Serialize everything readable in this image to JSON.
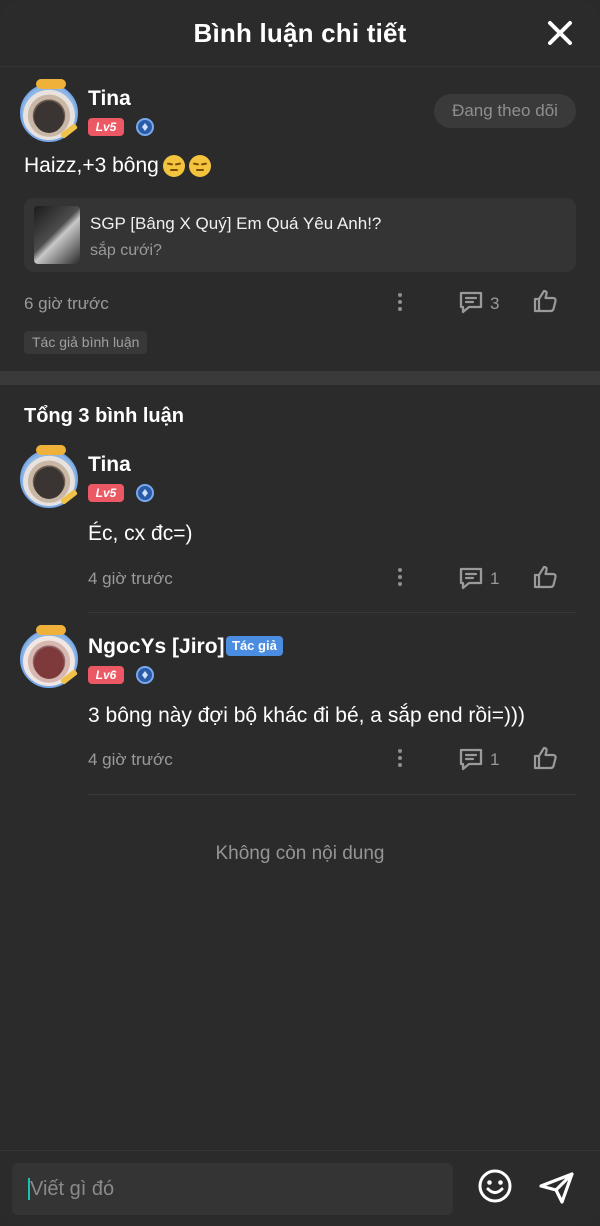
{
  "header": {
    "title": "Bình luận chi tiết"
  },
  "main_comment": {
    "author": "Tina",
    "level": "Lv5",
    "follow_label": "Đang theo dõi",
    "text": "Haizz,+3 bông",
    "story": {
      "title": "SGP [Bâng X Quý] Em Quá Yêu Anh!?",
      "subtitle": "sắp cưới?"
    },
    "time": "6 giờ trước",
    "reply_count": "3",
    "tag": "Tác giả bình luận"
  },
  "replies_header": "Tổng 3 bình luận",
  "replies": [
    {
      "author": "Tina",
      "level": "Lv5",
      "text": "Éc, cx đc=)",
      "time": "4 giờ trước",
      "reply_count": "1"
    },
    {
      "author": "NgocYs [Jiro]",
      "author_badge": "Tác giả",
      "level": "Lv6",
      "text": "3 bông này đợi bộ khác đi bé, a sắp end rồi=)))",
      "time": "4 giờ trước",
      "reply_count": "1"
    }
  ],
  "end_message": "Không còn nội dung",
  "composer": {
    "placeholder": "Viết gì đó"
  },
  "colors": {
    "background": "#2b2b2b",
    "level_badge": "#ec5864",
    "author_badge": "#4a8de1",
    "caret": "#17c3b2"
  },
  "icons": [
    "close-icon",
    "shield-icon",
    "more-icon",
    "comment-icon",
    "like-icon",
    "emoji-icon",
    "send-icon"
  ]
}
